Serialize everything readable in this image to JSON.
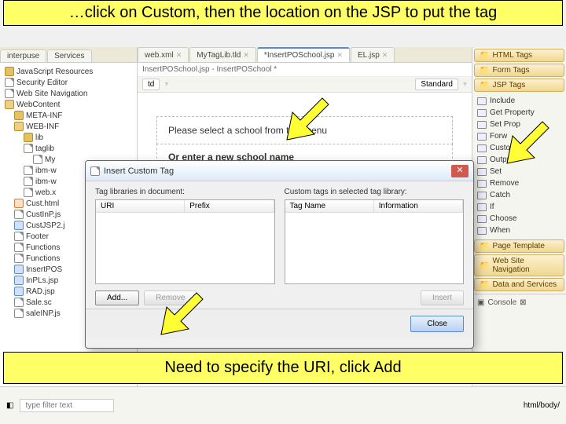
{
  "banners": {
    "top": "…click on Custom, then the location on the JSP to put the tag",
    "bottom": "Need to specify the URI, click Add"
  },
  "left_tabs": [
    "interpuse",
    "Services"
  ],
  "tree": [
    {
      "label": "JavaScript Resources",
      "icon": "folder",
      "ind": 0
    },
    {
      "label": "Security Editor",
      "icon": "file",
      "ind": 0
    },
    {
      "label": "Web Site Navigation",
      "icon": "file",
      "ind": 0
    },
    {
      "label": "WebContent",
      "icon": "folder-open",
      "ind": 0
    },
    {
      "label": "META-INF",
      "icon": "folder",
      "ind": 1
    },
    {
      "label": "WEB-INF",
      "icon": "folder-open",
      "ind": 1
    },
    {
      "label": "lib",
      "icon": "folder",
      "ind": 2
    },
    {
      "label": "taglib",
      "icon": "file",
      "ind": 2
    },
    {
      "label": "My",
      "icon": "file",
      "ind": 3
    },
    {
      "label": "ibm-w",
      "icon": "file",
      "ind": 2
    },
    {
      "label": "ibm-w",
      "icon": "file",
      "ind": 2
    },
    {
      "label": "web.x",
      "icon": "file",
      "ind": 2
    },
    {
      "label": "Cust.html",
      "icon": "html",
      "ind": 1
    },
    {
      "label": "CustInP.js",
      "icon": "file",
      "ind": 1
    },
    {
      "label": "CustJSP2.j",
      "icon": "jsp",
      "ind": 1
    },
    {
      "label": "Footer",
      "icon": "file",
      "ind": 1
    },
    {
      "label": "Functions",
      "icon": "file",
      "ind": 1
    },
    {
      "label": "Functions",
      "icon": "file",
      "ind": 1
    },
    {
      "label": "InsertPOS",
      "icon": "jsp",
      "ind": 1
    },
    {
      "label": "InPLs.jsp",
      "icon": "jsp",
      "ind": 1
    },
    {
      "label": "RAD.jsp",
      "icon": "jsp",
      "ind": 1
    },
    {
      "label": "Sale.sc",
      "icon": "file",
      "ind": 1
    },
    {
      "label": "saleINP.js",
      "icon": "file",
      "ind": 1
    }
  ],
  "editor_tabs": [
    {
      "label": "web.xml"
    },
    {
      "label": "MyTagLib.tld"
    },
    {
      "label": "*InsertPOSchool.jsp",
      "active": true
    },
    {
      "label": "EL.jsp"
    }
  ],
  "subtitle": "InsertPOSchool.jsp - InsertPOSchool *",
  "breadcrumb": {
    "td": "td",
    "style": "Standard"
  },
  "editor_lines": [
    "Please select a school from this menu",
    "Or enter a new school name"
  ],
  "palette": {
    "cats": [
      "HTML Tags",
      "Form Tags",
      "JSP Tags"
    ],
    "items": [
      "Include",
      "Get Property",
      "Set Prop",
      "Forw",
      "Custom",
      "Output",
      "Set",
      "Remove",
      "Catch",
      "If",
      "Choose",
      "When"
    ],
    "cats2": [
      "Page Template",
      "Web Site Navigation",
      "Data and Services"
    ],
    "console": "Console"
  },
  "dialog": {
    "title": "Insert Custom Tag",
    "left_label": "Tag libraries in document:",
    "right_label": "Custom tags in selected tag library:",
    "left_cols": [
      "URI",
      "Prefix"
    ],
    "right_cols": [
      "Tag Name",
      "Information"
    ],
    "add": "Add...",
    "remove": "Remove",
    "insert": "Insert",
    "close": "Close"
  },
  "bottombar": {
    "filter_placeholder": "type filter text",
    "path": "html/body/"
  }
}
